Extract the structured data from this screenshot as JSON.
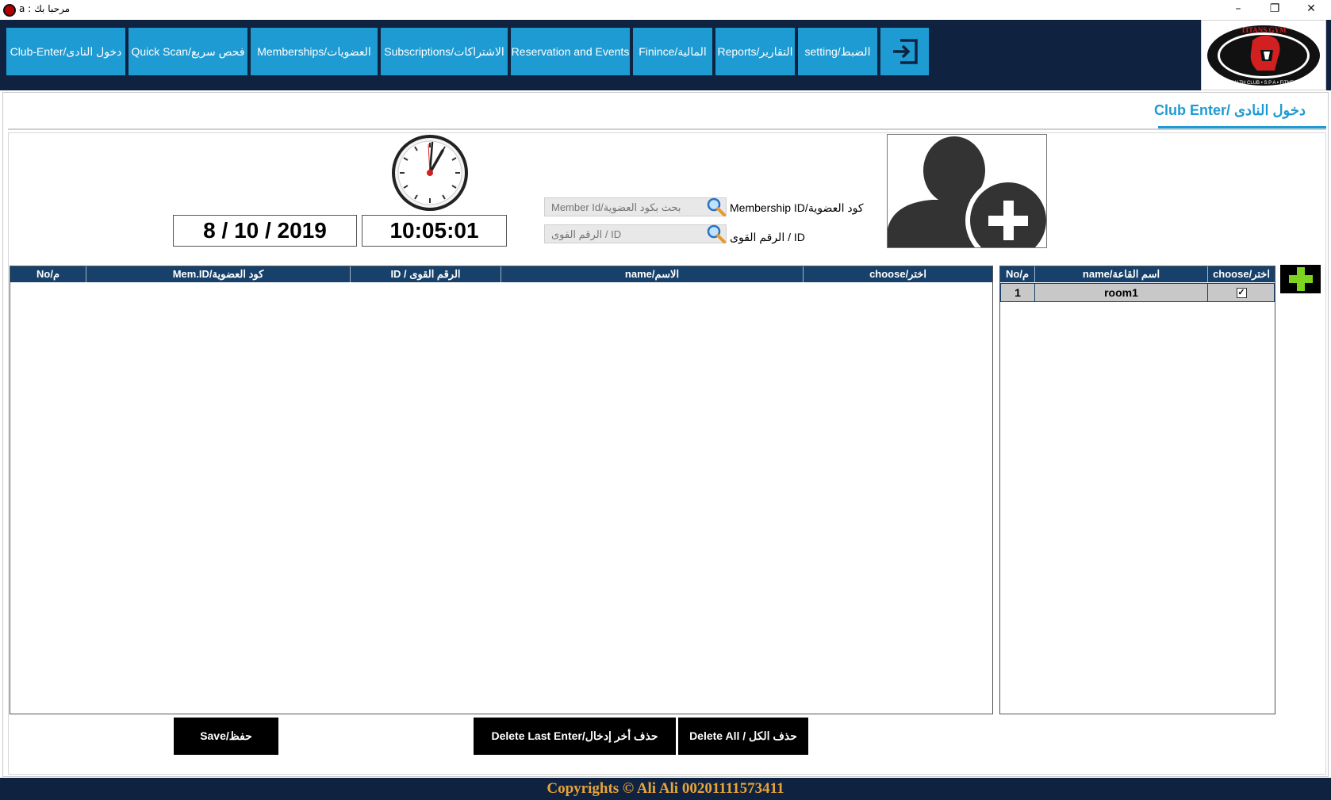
{
  "window": {
    "title": "a : مرحبا بك",
    "minimize": "–",
    "restore": "❐",
    "close": "✕"
  },
  "nav": {
    "items": [
      "Club-Enter/دخول النادى",
      "Quick Scan/فحص سريع",
      "Memberships/العضويات",
      "Subscriptions/الاشتراكات",
      "Reservation and Events",
      "Finince/المالية",
      "Reports/التقارير",
      "setting/الضبط"
    ],
    "exit_icon": "exit-icon"
  },
  "logo": {
    "top_text": "TITANS GYM",
    "side_text": "HEALTH CLUB • S P A • FITNESS"
  },
  "page": {
    "title": "Club Enter/ دخول النادى"
  },
  "datetime": {
    "date": "8 / 10 / 2019",
    "time": "10:05:01"
  },
  "search": {
    "membership_placeholder": "Member Id/بحث بكود العضوية",
    "membership_label": "Membership ID/كود العضوية",
    "id_placeholder": "الرقم القوى / ID",
    "id_label": "الرقم القوى / ID"
  },
  "members_table": {
    "columns": [
      "No/م",
      "Mem.ID/كود العضوية",
      "ID / الرقم القوى",
      "name/الاسم",
      "choose/اختر"
    ],
    "rows": []
  },
  "rooms_table": {
    "columns": [
      "No/م",
      "name/اسم القاعة",
      "choose/اختر"
    ],
    "rows": [
      {
        "no": "1",
        "name": "room1",
        "checked": true
      }
    ]
  },
  "buttons": {
    "save": "Save/حفظ",
    "delete_last": "Delete Last Enter/حذف أخر إدخال",
    "delete_all": "Delete All / حذف الكل"
  },
  "footer": {
    "copyright": "Copyrights  ©  Ali Ali 00201111573411"
  },
  "colors": {
    "nav_bg": "#0f2340",
    "accent": "#1e9bd2",
    "table_header": "#17416a",
    "add_green": "#7ed321",
    "footer_text": "#e8a33a"
  }
}
